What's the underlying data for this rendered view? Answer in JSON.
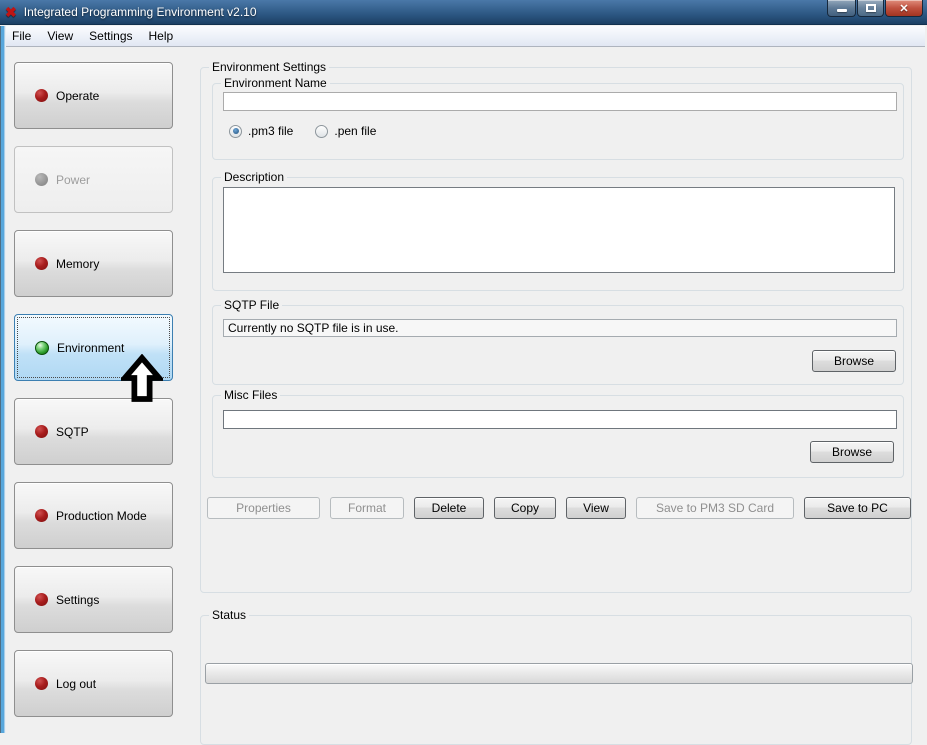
{
  "window": {
    "title": "Integrated Programming Environment v2.10"
  },
  "icons": {
    "app_logo": "✖",
    "close": "✕"
  },
  "menu": {
    "items": [
      "File",
      "View",
      "Settings",
      "Help"
    ]
  },
  "sidebar": {
    "items": [
      {
        "label": "Operate",
        "state": "enabled",
        "dot_color": "#a11616"
      },
      {
        "label": "Power",
        "state": "disabled",
        "dot_color": "#9b9b9b"
      },
      {
        "label": "Memory",
        "state": "enabled",
        "dot_color": "#a11616"
      },
      {
        "label": "Environment",
        "state": "selected",
        "dot_color": "#2fa02f"
      },
      {
        "label": "SQTP",
        "state": "enabled",
        "dot_color": "#a11616"
      },
      {
        "label": "Production Mode",
        "state": "enabled",
        "dot_color": "#a11616"
      },
      {
        "label": "Settings",
        "state": "enabled",
        "dot_color": "#a11616"
      },
      {
        "label": "Log out",
        "state": "enabled",
        "dot_color": "#a11616"
      }
    ]
  },
  "main": {
    "group_title": "Environment Settings",
    "environment_name": {
      "label": "Environment Name",
      "value": "",
      "file_type_options": [
        {
          "label": ".pm3 file",
          "selected": true
        },
        {
          "label": ".pen file",
          "selected": false
        }
      ]
    },
    "description": {
      "label": "Description",
      "value": ""
    },
    "sqtp_file": {
      "label": "SQTP File",
      "value": "Currently no SQTP file is in use.",
      "browse_label": "Browse"
    },
    "misc_files": {
      "label": "Misc Files",
      "value": "",
      "browse_label": "Browse"
    },
    "actions": [
      {
        "label": "Properties",
        "enabled": false
      },
      {
        "label": "Format",
        "enabled": false
      },
      {
        "label": "Delete",
        "enabled": true
      },
      {
        "label": "Copy",
        "enabled": true
      },
      {
        "label": "View",
        "enabled": true
      },
      {
        "label": "Save to PM3 SD Card",
        "enabled": false
      },
      {
        "label": "Save to PC",
        "enabled": true
      }
    ],
    "status": {
      "label": "Status",
      "progress_percent": 0
    }
  },
  "colors": {
    "selected_accent": "#3c7fb1",
    "selected_bg": "#cde9fb",
    "red_indicator": "#a11616",
    "green_indicator": "#2fa02f",
    "titlebar_top": "#4a78a8",
    "titlebar_bottom": "#1c3f63",
    "close_button_red": "#c05140"
  }
}
